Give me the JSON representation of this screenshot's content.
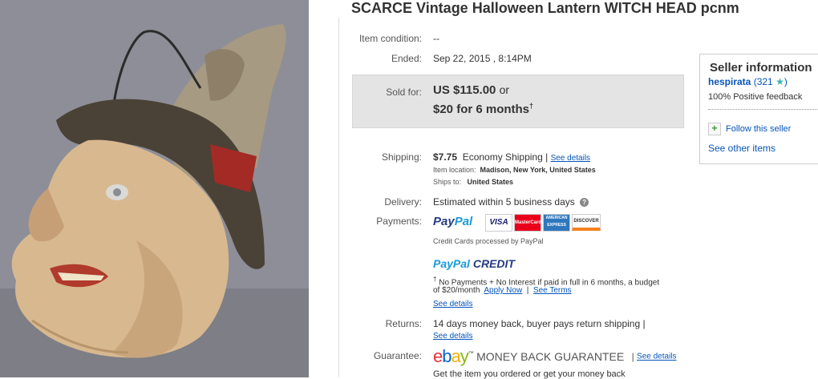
{
  "title": "SCARCE Vintage Halloween Lantern WITCH HEAD pcnm",
  "labels": {
    "condition": "Item condition:",
    "ended": "Ended:",
    "sold_for": "Sold for:",
    "shipping": "Shipping:",
    "delivery": "Delivery:",
    "payments": "Payments:",
    "returns": "Returns:",
    "guarantee": "Guarantee:"
  },
  "values": {
    "condition": "--",
    "ended": "Sep 22, 2015 , 8:14PM",
    "price": "US $115.00",
    "price_or": "or",
    "financing": "$20 for 6 months",
    "financing_mark": "†",
    "ship_cost": "$7.75",
    "ship_method": "Economy Shipping |",
    "see_details": "See details",
    "item_location_label": "Item location:",
    "item_location": "Madison, New York, United States",
    "ships_to_label": "Ships to:",
    "ships_to": "United States",
    "delivery": "Estimated within 5 business days",
    "help_glyph": "?",
    "paypal_pay": "Pay",
    "paypal_pal": "Pal",
    "cards_note": "Credit Cards processed by PayPal",
    "credit_pay": "PayPal",
    "credit_word": "CREDIT",
    "credit_mark": "†",
    "credit_note1": "No Payments + No Interest if paid in full in 6 months, a budget",
    "credit_note2": "of $20/month",
    "apply_now": "Apply Now",
    "see_terms": "See Terms",
    "returns": "14 days money back, buyer pays return shipping |",
    "guarantee_logo": "ebay",
    "guarantee_tm": "™",
    "guarantee_text": "MONEY BACK GUARANTEE",
    "guarantee_sep": "|",
    "guarantee_note": "Get the item you ordered or get your money back"
  },
  "cards": [
    "VISA",
    "MasterCard",
    "AMERICAN EXPRESS",
    "DISCOVER"
  ],
  "seller": {
    "heading": "Seller information",
    "name": "hespirata",
    "score": "(321",
    "score_close": ")",
    "star_icon": "★",
    "feedback": "100% Positive feedback",
    "follow": "Follow this seller",
    "other": "See other items"
  },
  "colors": {
    "link": "#0654ba",
    "ebay_e": "#e53238",
    "ebay_b": "#0064d2",
    "ebay_a": "#f5af02",
    "ebay_y": "#86b817",
    "paypal_dark": "#253b80",
    "paypal_light": "#179bd7",
    "star": "#3ab5b0"
  }
}
